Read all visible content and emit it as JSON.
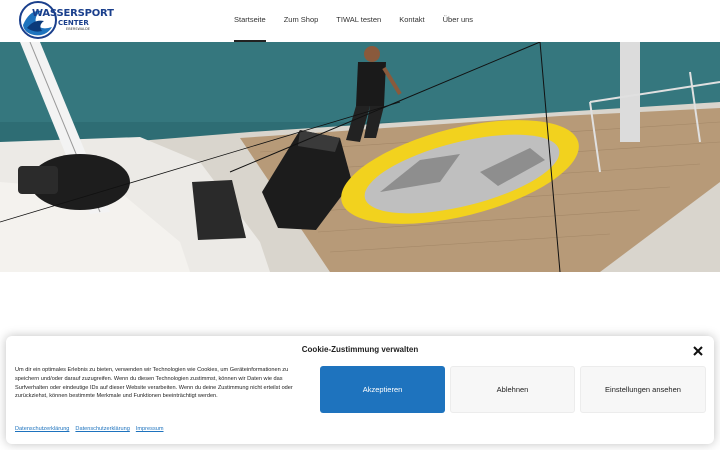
{
  "logo": {
    "line1": "WASSERSPORT",
    "line2": "CENTER",
    "line3": "EBERSWALDE"
  },
  "nav": {
    "items": [
      {
        "label": "Startseite",
        "active": true
      },
      {
        "label": "Zum Shop"
      },
      {
        "label": "TIWAL testen"
      },
      {
        "label": "Kontakt"
      },
      {
        "label": "Über uns"
      }
    ]
  },
  "hero": {
    "description": "Man on sailboat deck with yellow-grey inflatable dinghy"
  },
  "cookie": {
    "title": "Cookie-Zustimmung verwalten",
    "text": "Um dir ein optimales Erlebnis zu bieten, verwenden wir Technologien wie Cookies, um Geräteinformationen zu speichern und/oder darauf zuzugreifen. Wenn du diesen Technologien zustimmst, können wir Daten wie das Surfverhalten oder eindeutige IDs auf dieser Website verarbeiten. Wenn du deine Zustimmung nicht erteilst oder zurückziehst, können bestimmte Merkmale und Funktionen beeinträchtigt werden.",
    "accept_label": "Akzeptieren",
    "deny_label": "Ablehnen",
    "settings_label": "Einstellungen ansehen",
    "links": [
      "Datenschutzerklärung",
      "Datenschutzerklärung",
      "Impressum"
    ]
  },
  "colors": {
    "accent": "#1e73be",
    "logo_blue": "#1a3f8c"
  }
}
